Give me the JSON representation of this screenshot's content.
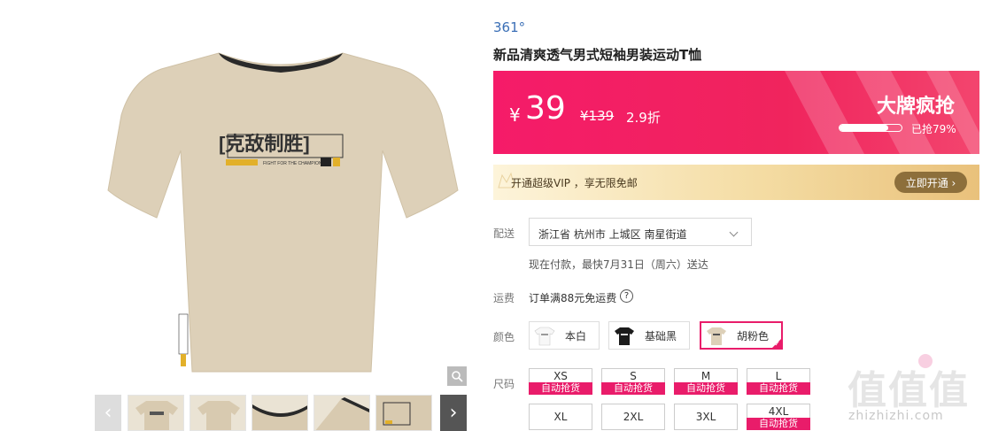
{
  "product": {
    "brand": "361°",
    "title": "新品清爽透气男式短袖男装运动T恤",
    "tee_print": {
      "main": "[克敌制胜]",
      "sub": "FIGHT FOR THE CHAMPION",
      "brand_mark": "361°",
      "side_print": "FIGHT FOR THE CHAMPION"
    }
  },
  "price": {
    "currency": "¥",
    "current": "39",
    "original": "¥139",
    "discount": "2.9折",
    "promo_title": "大牌疯抢",
    "sold_ratio": 0.79,
    "sold_text": "已抢79%"
  },
  "vip": {
    "text": "开通超级VIP ，享无限免邮",
    "button": "立即开通 ›"
  },
  "delivery": {
    "label": "配送",
    "address": "浙江省 杭州市 上城区 南星街道",
    "note": "现在付款，最快7月31日（周六）送达"
  },
  "shipping": {
    "label": "运费",
    "text": "订单满88元免运费",
    "help_icon": "?"
  },
  "colors": {
    "label": "颜色",
    "options": [
      {
        "name": "本白",
        "swatch": "#f4f4f4",
        "selected": false
      },
      {
        "name": "基础黑",
        "swatch": "#1c1c1c",
        "selected": true
      },
      {
        "name": "胡粉色",
        "swatch": "#ddd0b8",
        "selected": true
      }
    ]
  },
  "sizes": {
    "label": "尺码",
    "tag": "自动抢货",
    "options": [
      {
        "name": "XS",
        "tag": true
      },
      {
        "name": "S",
        "tag": true
      },
      {
        "name": "M",
        "tag": true
      },
      {
        "name": "L",
        "tag": true
      },
      {
        "name": "XL",
        "tag": false
      },
      {
        "name": "2XL",
        "tag": false
      },
      {
        "name": "3XL",
        "tag": false
      },
      {
        "name": "4XL",
        "tag": true
      }
    ]
  },
  "watermark": {
    "logo": "值",
    "site": "zhizhizhi.com"
  },
  "colors_theme": {
    "accent": "#e91c6a",
    "brand": "#3b6fb6",
    "vip_button": "#8d6f3b"
  }
}
